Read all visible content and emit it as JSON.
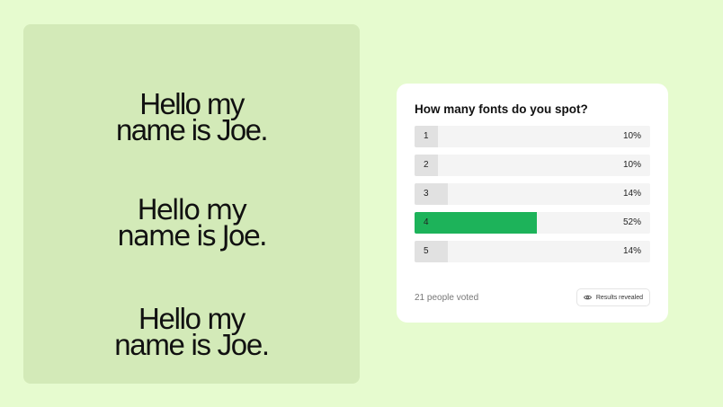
{
  "samples": [
    {
      "line1": "Hello my",
      "line2": "name is Joe."
    },
    {
      "line1": "Hello my",
      "line2": "name is Joe."
    },
    {
      "line1": "Hello my",
      "line2": "name is Joe."
    }
  ],
  "poll": {
    "question": "How many fonts do you spot?",
    "options": [
      {
        "label": "1",
        "percent": "10%",
        "fraction": 0.1,
        "selected": false
      },
      {
        "label": "2",
        "percent": "10%",
        "fraction": 0.1,
        "selected": false
      },
      {
        "label": "3",
        "percent": "14%",
        "fraction": 0.14,
        "selected": false
      },
      {
        "label": "4",
        "percent": "52%",
        "fraction": 0.52,
        "selected": true
      },
      {
        "label": "5",
        "percent": "14%",
        "fraction": 0.14,
        "selected": false
      }
    ],
    "voted": "21 people voted",
    "results_button": {
      "label": "Results revealed",
      "icon": "eye-icon"
    },
    "accent_color": "#1db35a"
  }
}
